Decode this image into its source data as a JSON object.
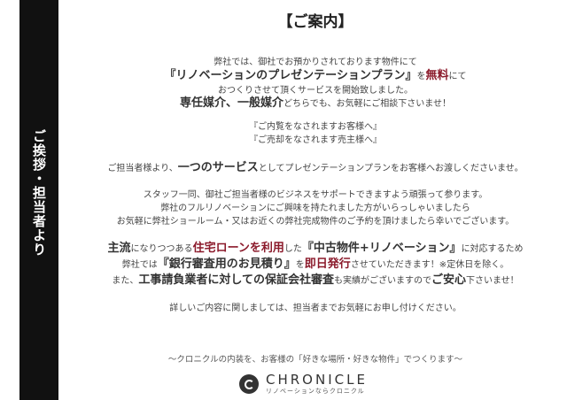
{
  "sidebar": {
    "label": "ご挨拶・担当者より"
  },
  "title": "【ご案内】",
  "lines": {
    "l1": "弊社では、御社でお預かりされております物件にて",
    "l2a": "『リノベーションのプレゼンテーションプラン』",
    "l2b": "を",
    "l2c": "無料",
    "l2d": "にて",
    "l3": "おつくりさせて頂くサービスを開始致しました。",
    "l4a": "専任媒介",
    "l4b": "、",
    "l4c": "一般媒介",
    "l4d": "どちらでも、お気軽にご相談下さいませ！",
    "l5": "『ご内覧をなされますお客様へ』",
    "l6": "『ご売却をなされます売主様へ』",
    "l7a": "ご担当者様より、",
    "l7b": "一つのサービス",
    "l7c": "としてプレゼンテーションプランをお客様へお渡しくださいませ。",
    "l8": "スタッフ一同、御社ご担当者様のビジネスをサポートできますよう頑張って参ります。",
    "l9": "弊社のフルリノベーションにご興味を持たれました方がいらっしゃいましたら",
    "l10": "お気軽に弊社ショールーム・又はお近くの弊社完成物件のご予約を頂けましたら幸いでございます。",
    "l11a": "主流",
    "l11b": "になりつつある",
    "l11c": "住宅ローンを利用",
    "l11d": "した",
    "l11e": "『中古物件+リノベーション』",
    "l11f": "に対応するため",
    "l12a": "弊社では",
    "l12b": "『銀行審査用のお見積り』",
    "l12c": "を",
    "l12d": "即日発行",
    "l12e": "させていただきます！※定休日を除く。",
    "l13a": "また、",
    "l13b": "工事請負業者に対しての保証会社審査",
    "l13c": "も実績がございますので",
    "l13d": "ご安心",
    "l13e": "下さいませ！",
    "l14": "詳しいご内容に関しましては、担当者までお気軽にお申し付けください。"
  },
  "footer": {
    "tagline": "～クロニクルの内装を、お客様の「好きな場所・好きな物件」でつくります～",
    "logo_word": "CHRONICLE",
    "logo_sub": "リノベーションならクロニクル"
  },
  "colors": {
    "accent": "#8b1a2b",
    "sidebar": "#111111"
  }
}
